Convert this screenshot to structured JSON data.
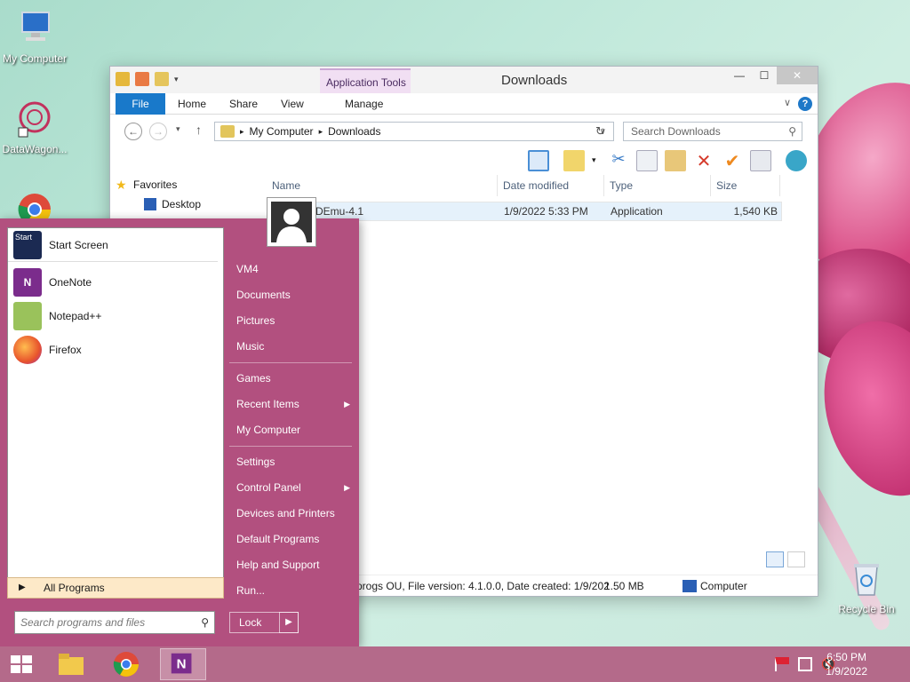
{
  "desktop": {
    "icons": [
      {
        "label": "My Computer"
      },
      {
        "label": "DataWagon..."
      },
      {
        "label": "Recycle Bin"
      }
    ]
  },
  "explorer": {
    "title": "Downloads",
    "context_tab_group": "Application Tools",
    "ribbon_tabs": [
      "File",
      "Home",
      "Share",
      "View",
      "Manage"
    ],
    "address": [
      "My Computer",
      "Downloads"
    ],
    "search_placeholder": "Search Downloads",
    "sidebar": [
      {
        "label": "Favorites"
      },
      {
        "label": "Desktop"
      }
    ],
    "columns": [
      "Name",
      "Date modified",
      "Type",
      "Size"
    ],
    "files": [
      {
        "name": "DEmu-4.1",
        "date": "1/9/2022 5:33 PM",
        "type": "Application",
        "size": "1,540 KB"
      }
    ],
    "status": {
      "details": "progs OU, File version: 4.1.0.0, Date created: 1/9/202",
      "size": "1.50 MB",
      "location": "Computer"
    }
  },
  "start_menu": {
    "pinned": [
      {
        "label": "Start Screen",
        "icon": "start-screen-icon"
      },
      {
        "label": "OneNote",
        "icon": "onenote-icon"
      },
      {
        "label": "Notepad++",
        "icon": "notepadpp-icon"
      },
      {
        "label": "Firefox",
        "icon": "firefox-icon"
      }
    ],
    "all_programs": "All Programs",
    "search_placeholder": "Search programs and files",
    "right_items": [
      "VM4",
      "Documents",
      "Pictures",
      "Music",
      "Games",
      "Recent Items",
      "My Computer",
      "Settings",
      "Control Panel",
      "Devices and Printers",
      "Default Programs",
      "Help and Support",
      "Run..."
    ],
    "lock": "Lock"
  },
  "taskbar": {
    "time": "6:50 PM",
    "date": "1/9/2022"
  },
  "colors": {
    "start_menu": "#b2507f",
    "taskbar": "#b46a8a",
    "file_tab": "#1979ca"
  }
}
